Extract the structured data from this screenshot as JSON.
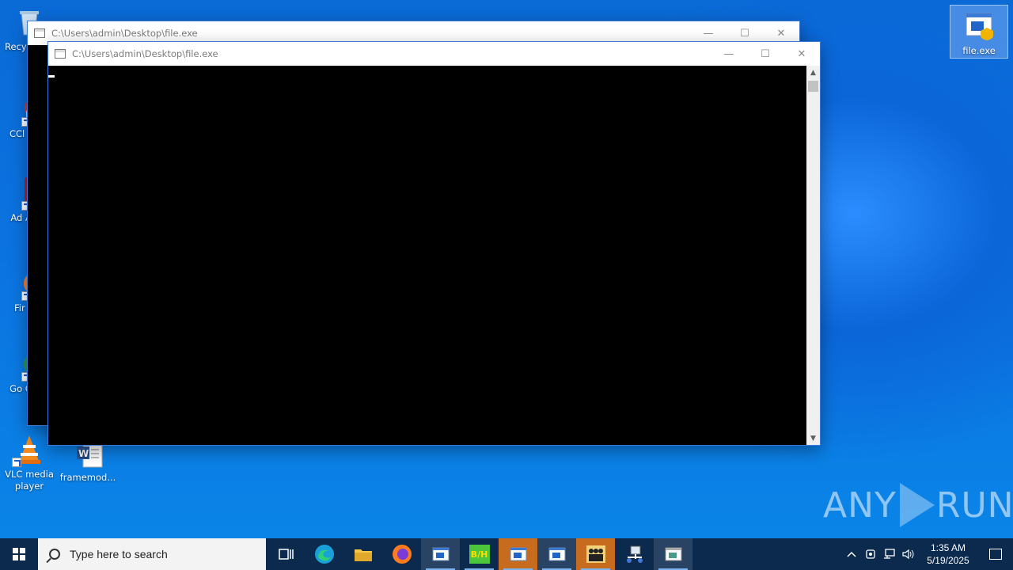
{
  "desktop": {
    "icons": [
      {
        "label": "Recy"
      },
      {
        "label": "CCl"
      },
      {
        "label": "Ad Acr"
      },
      {
        "label": "Fir"
      },
      {
        "label": "Go Chr"
      },
      {
        "label": "VLC media player"
      },
      {
        "label": "framemod..."
      },
      {
        "label": "file.exe"
      }
    ]
  },
  "windows": {
    "back": {
      "title": "C:\\Users\\admin\\Desktop\\file.exe"
    },
    "front": {
      "title": "C:\\Users\\admin\\Desktop\\file.exe"
    }
  },
  "window_controls": {
    "minimize": "—",
    "maximize": "☐",
    "close": "✕"
  },
  "scrollbar": {
    "up": "▲",
    "down": "▼"
  },
  "watermark": {
    "left": "ANY",
    "right": "RUN"
  },
  "taskbar": {
    "search_placeholder": "Type here to search",
    "apps": [
      {
        "name": "task-view"
      },
      {
        "name": "edge"
      },
      {
        "name": "file-explorer"
      },
      {
        "name": "firefox"
      },
      {
        "name": "console-window-1"
      },
      {
        "name": "bh-app"
      },
      {
        "name": "console-window-2"
      },
      {
        "name": "console-window-3"
      },
      {
        "name": "people-app"
      },
      {
        "name": "network-tool"
      },
      {
        "name": "console-window-4"
      }
    ],
    "bh_label": "B/H",
    "clock": {
      "time": "1:35 AM",
      "date": "5/19/2025"
    }
  },
  "colors": {
    "accent": "#0b2a4e",
    "highlight": "#c76b1e"
  }
}
